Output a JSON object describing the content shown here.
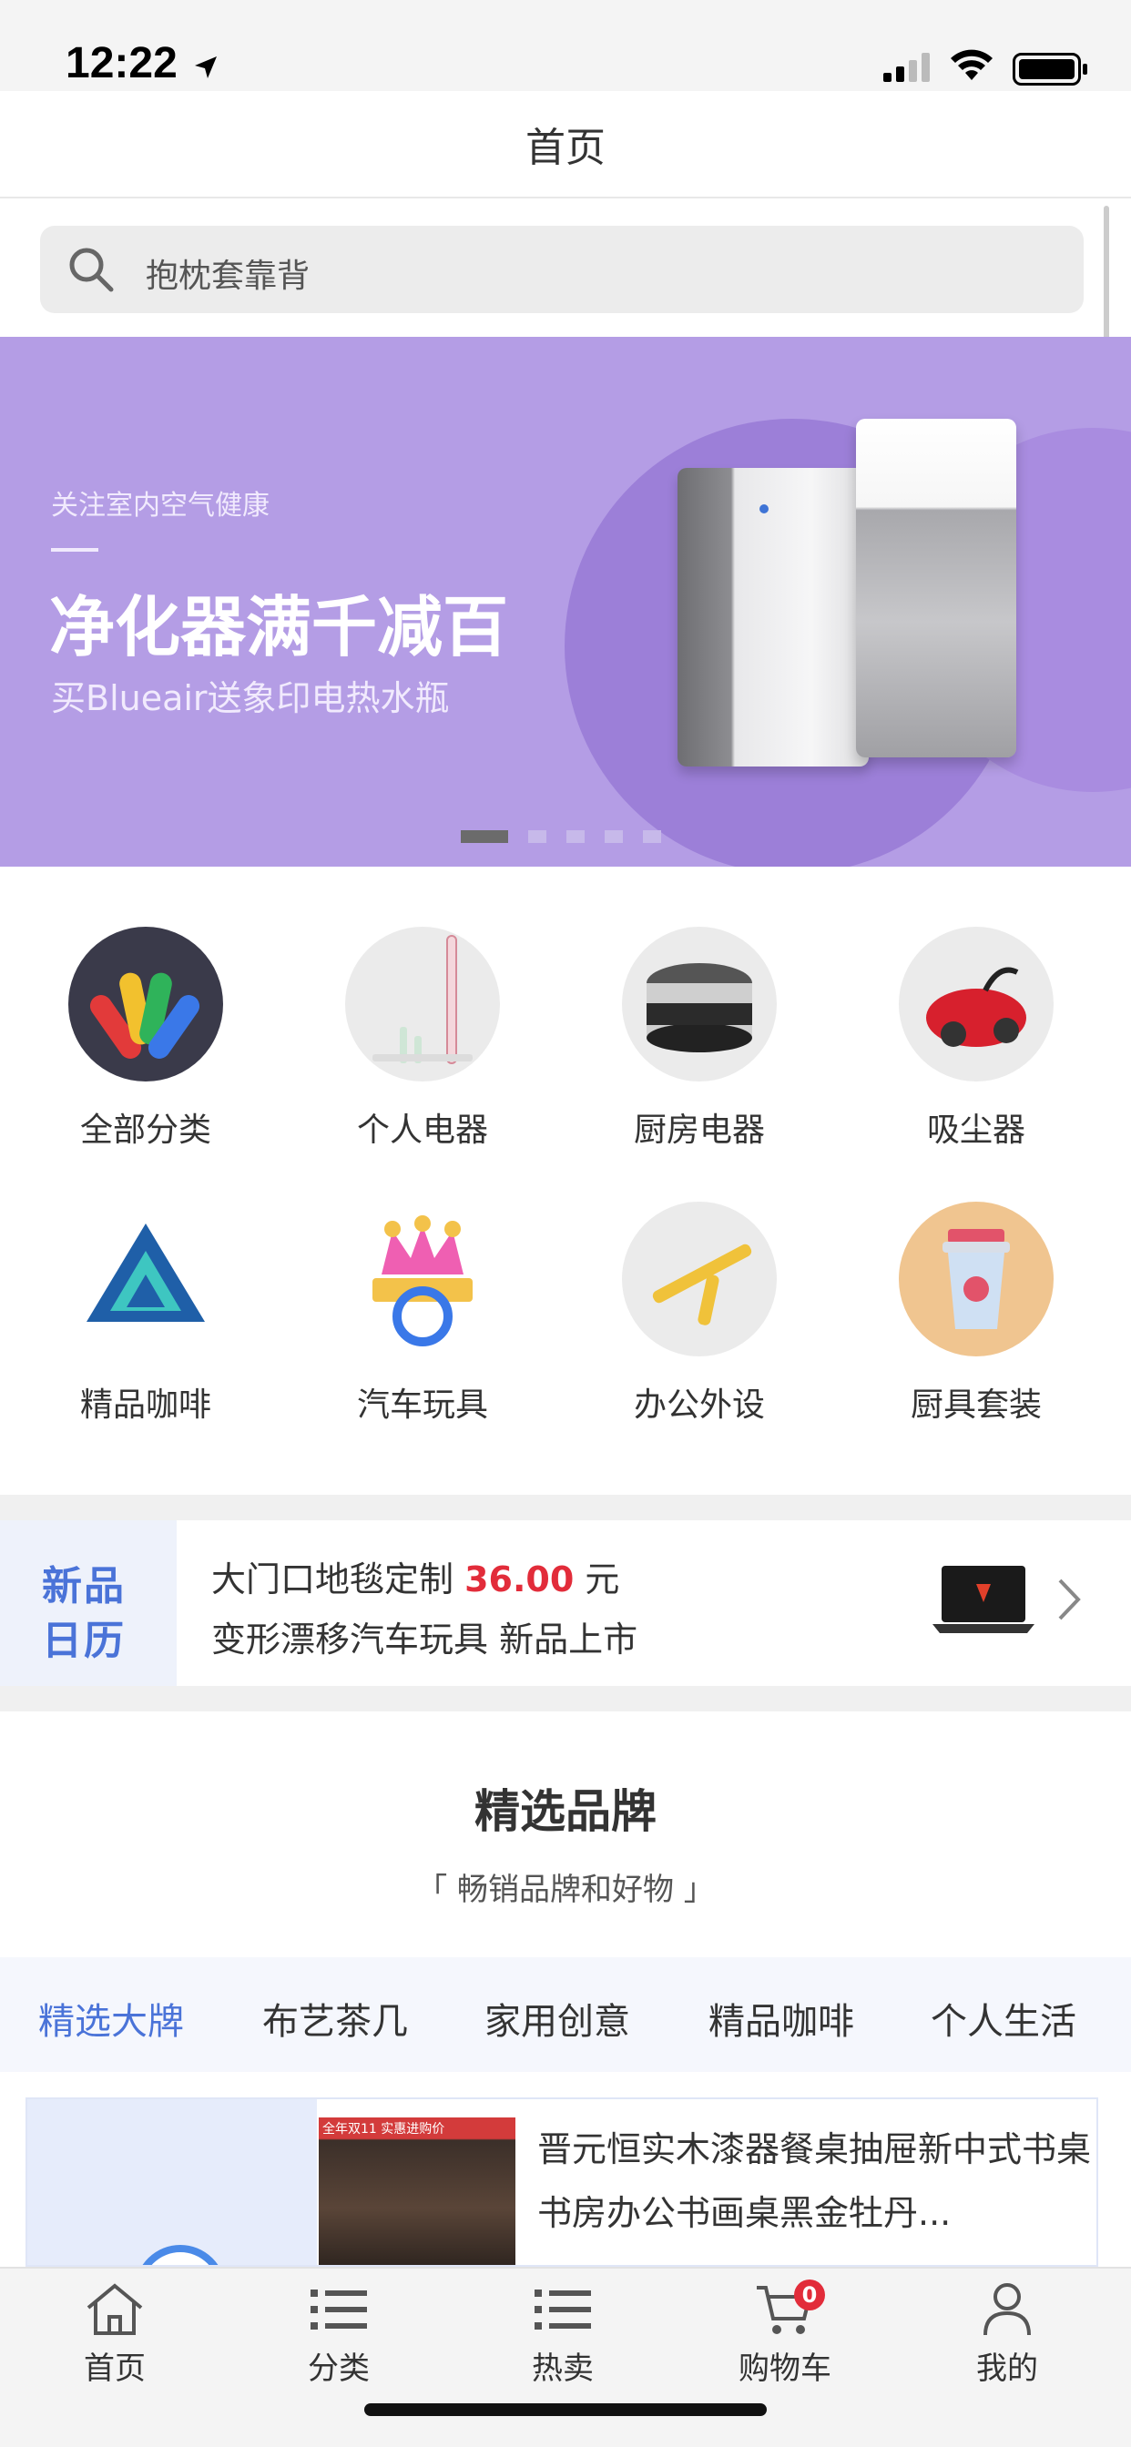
{
  "status_bar": {
    "time": "12:22"
  },
  "header": {
    "title": "首页"
  },
  "search": {
    "placeholder": "抱枕套靠背"
  },
  "banner": {
    "subtitle": "关注室内空气健康",
    "title": "净化器满千减百",
    "description": "买Blueair送象印电热水瓶",
    "slides": 5,
    "active_slide": 1
  },
  "categories": [
    {
      "label": "全部分类",
      "icon": "all-categories-icon"
    },
    {
      "label": "个人电器",
      "icon": "electric-toothbrush-icon"
    },
    {
      "label": "厨房电器",
      "icon": "rice-cooker-icon"
    },
    {
      "label": "吸尘器",
      "icon": "vacuum-cleaner-icon"
    },
    {
      "label": "精品咖啡",
      "icon": "triangle-logo-icon"
    },
    {
      "label": "汽车玩具",
      "icon": "crown-badge-icon"
    },
    {
      "label": "办公外设",
      "icon": "pen-icon"
    },
    {
      "label": "厨具套装",
      "icon": "cup-icon"
    }
  ],
  "new_products": {
    "badge_line1": "新品",
    "badge_line2": "日历",
    "line1_text": "大门口地毯定制",
    "line1_price": "36.00",
    "line1_unit": "元",
    "line2_text": "变形漂移汽车玩具 新品上市"
  },
  "brand": {
    "title": "精选品牌",
    "subtitle": "「 畅销品牌和好物 」",
    "tabs": [
      "精选大牌",
      "布艺茶几",
      "家用创意",
      "精品咖啡",
      "个人生活"
    ],
    "product": {
      "title": "晋元恒实木漆器餐桌抽屉新中式书桌书房办公书画桌黑金牡丹...",
      "image_caption": "全年双11 实惠进购价"
    }
  },
  "tabbar": {
    "items": [
      {
        "label": "首页",
        "icon": "home-icon"
      },
      {
        "label": "分类",
        "icon": "list-icon"
      },
      {
        "label": "热卖",
        "icon": "list-icon"
      },
      {
        "label": "购物车",
        "icon": "cart-icon"
      },
      {
        "label": "我的",
        "icon": "user-icon"
      }
    ],
    "cart_badge": "0"
  },
  "colors": {
    "banner_bg": "#b49de5",
    "accent_blue": "#4a73d8",
    "price_red": "#e22c3a"
  }
}
